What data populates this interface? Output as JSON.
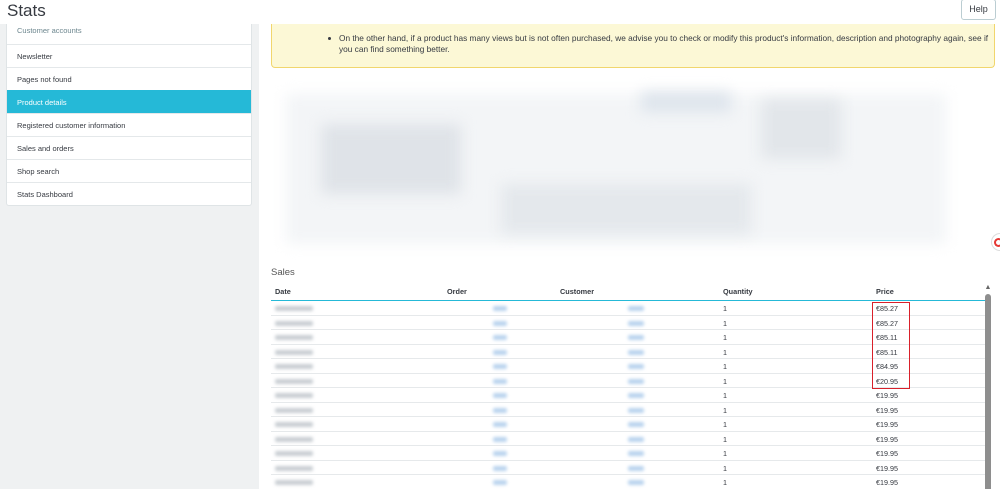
{
  "header": {
    "title": "Stats",
    "help_label": "Help"
  },
  "sidebar": {
    "items": [
      {
        "label": "Customer accounts"
      },
      {
        "label": "Newsletter"
      },
      {
        "label": "Pages not found"
      },
      {
        "label": "Product details",
        "active": true
      },
      {
        "label": "Registered customer information"
      },
      {
        "label": "Sales and orders"
      },
      {
        "label": "Shop search"
      },
      {
        "label": "Stats Dashboard"
      }
    ]
  },
  "alert": {
    "text": "On the other hand, if a product has many views but is not often purchased, we advise you to check or modify this product's information, description and photography again, see if you can find something better."
  },
  "sales": {
    "title": "Sales",
    "columns": [
      "Date",
      "Order",
      "Customer",
      "Quantity",
      "Price"
    ],
    "rows": [
      {
        "quantity": "1",
        "price": "€85.27"
      },
      {
        "quantity": "1",
        "price": "€85.27"
      },
      {
        "quantity": "1",
        "price": "€85.11"
      },
      {
        "quantity": "1",
        "price": "€85.11"
      },
      {
        "quantity": "1",
        "price": "€84.95"
      },
      {
        "quantity": "1",
        "price": "€20.95"
      },
      {
        "quantity": "1",
        "price": "€19.95"
      },
      {
        "quantity": "1",
        "price": "€19.95"
      },
      {
        "quantity": "1",
        "price": "€19.95"
      },
      {
        "quantity": "1",
        "price": "€19.95"
      },
      {
        "quantity": "1",
        "price": "€19.95"
      },
      {
        "quantity": "1",
        "price": "€19.95"
      },
      {
        "quantity": "1",
        "price": "€19.95"
      }
    ]
  },
  "colors": {
    "accent": "#25b9d7",
    "highlight_border": "#d9202a",
    "alert_bg": "#fcf8d6"
  },
  "icons": {
    "widget": "circular-arrow-icon",
    "scroll_up": "arrow-up-icon"
  }
}
